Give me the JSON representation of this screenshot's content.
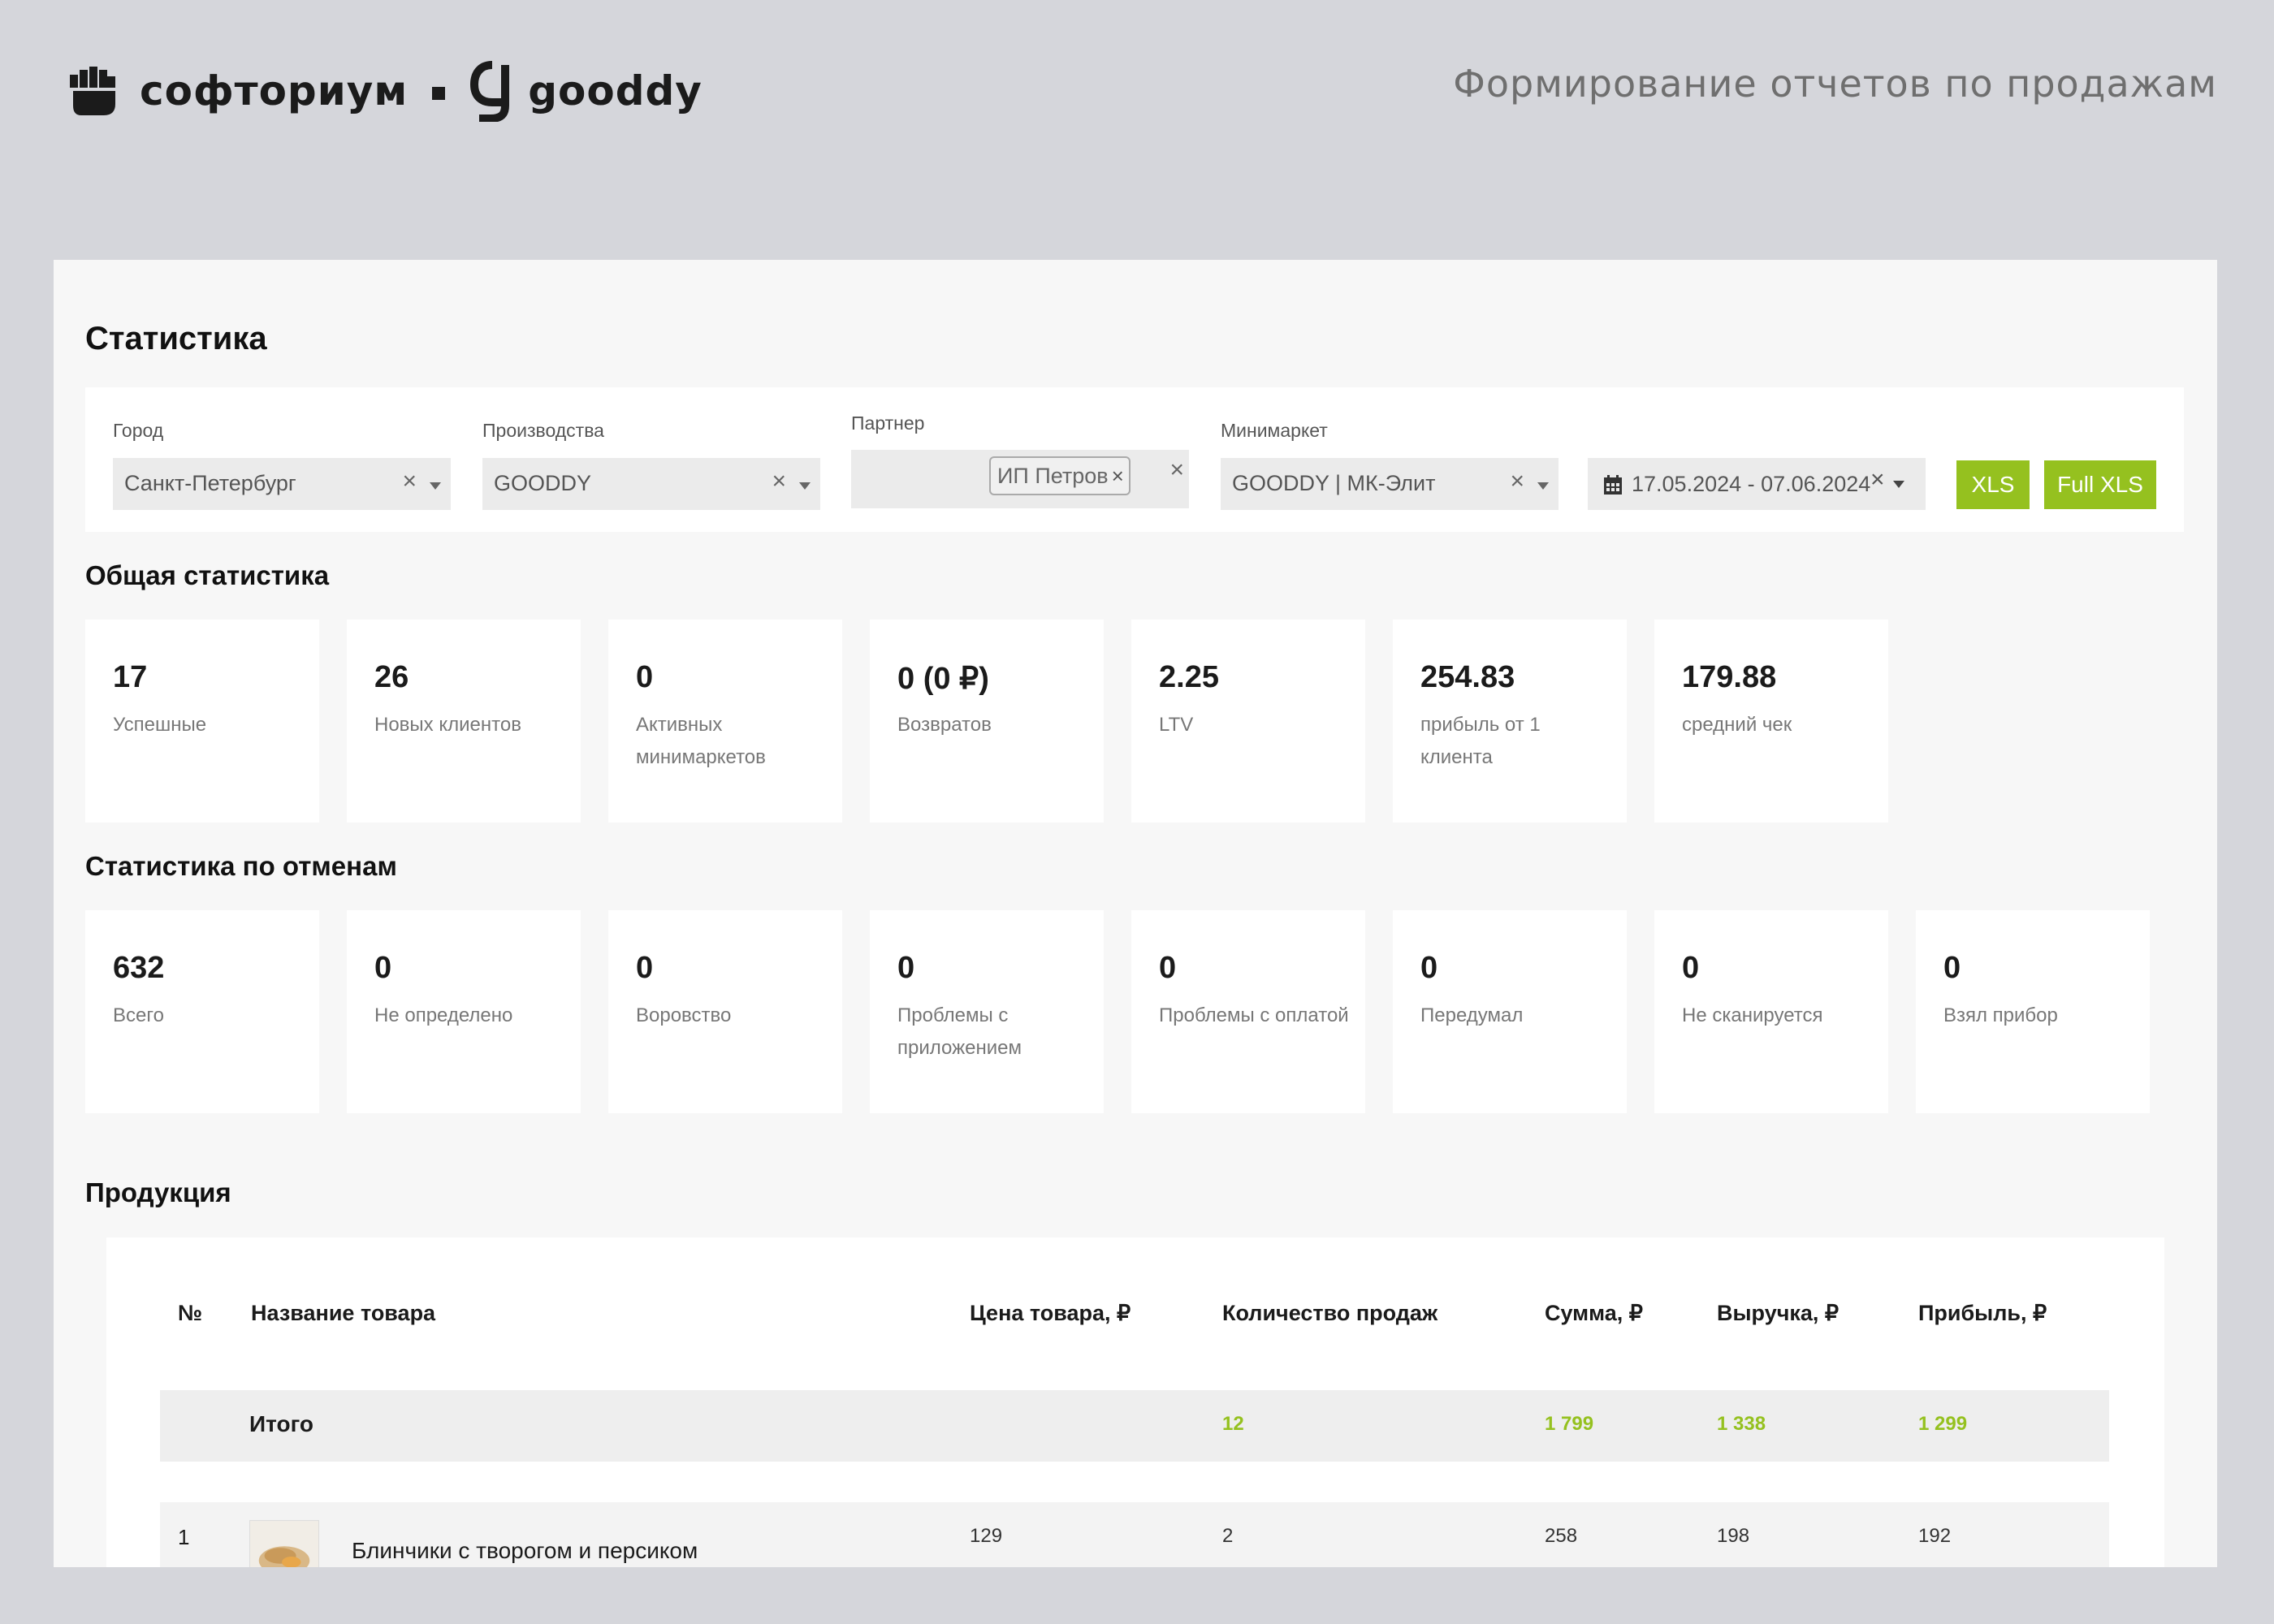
{
  "header": {
    "brand_name": "софториум",
    "partner_brand": "gooddy",
    "title": "Формирование отчетов по продажам"
  },
  "page": {
    "title": "Статистика"
  },
  "filters": {
    "city": {
      "label": "Город",
      "value": "Санкт-Петербург",
      "clear": "×"
    },
    "production": {
      "label": "Производства",
      "value": "GOODDY",
      "clear": "×"
    },
    "partner": {
      "label": "Партнер",
      "tag": "ИП Петров",
      "tag_clear": "×",
      "clear": "×"
    },
    "minimarket": {
      "label": "Минимаркет",
      "value": "GOODDY | МК-Элит",
      "clear": "×"
    },
    "date_range": {
      "value": "17.05.2024 - 07.06.2024",
      "clear": "×"
    },
    "xls_button": "XLS",
    "full_xls_button": "Full XLS"
  },
  "general_stats": {
    "title": "Общая статистика",
    "cards": [
      {
        "value": "17",
        "label": "Успешные"
      },
      {
        "value": "26",
        "label": "Новых клиентов"
      },
      {
        "value": "0",
        "label": "Активных минимаркетов"
      },
      {
        "value": "0 (0 ₽)",
        "label": "Возвратов"
      },
      {
        "value": "2.25",
        "label": "LTV"
      },
      {
        "value": "254.83",
        "label": "прибыль от 1 клиента"
      },
      {
        "value": "179.88",
        "label": "средний чек"
      }
    ]
  },
  "cancel_stats": {
    "title": "Статистика по отменам",
    "cards": [
      {
        "value": "632",
        "label": "Всего"
      },
      {
        "value": "0",
        "label": "Не определено"
      },
      {
        "value": "0",
        "label": "Воровство"
      },
      {
        "value": "0",
        "label": "Проблемы с приложением"
      },
      {
        "value": "0",
        "label": "Проблемы с оплатой"
      },
      {
        "value": "0",
        "label": "Передумал"
      },
      {
        "value": "0",
        "label": "Не сканируется"
      },
      {
        "value": "0",
        "label": "Взял прибор"
      }
    ]
  },
  "products": {
    "title": "Продукция",
    "columns": [
      "№",
      "Название товара",
      "Цена товара, ₽",
      "Количество продаж",
      "Сумма, ₽",
      "Выручка, ₽",
      "Прибыль, ₽"
    ],
    "total": {
      "label": "Итого",
      "quantity": "12",
      "sum": "1 799",
      "revenue": "1 338",
      "profit": "1 299"
    },
    "rows": [
      {
        "num": "1",
        "name": "Блинчики с творогом и персиком",
        "price": "129",
        "quantity": "2",
        "sum": "258",
        "revenue": "198",
        "profit": "192"
      }
    ]
  },
  "colors": {
    "accent": "#95c11f",
    "page_bg": "#d5d6db",
    "panel_bg": "#f7f7f7"
  }
}
